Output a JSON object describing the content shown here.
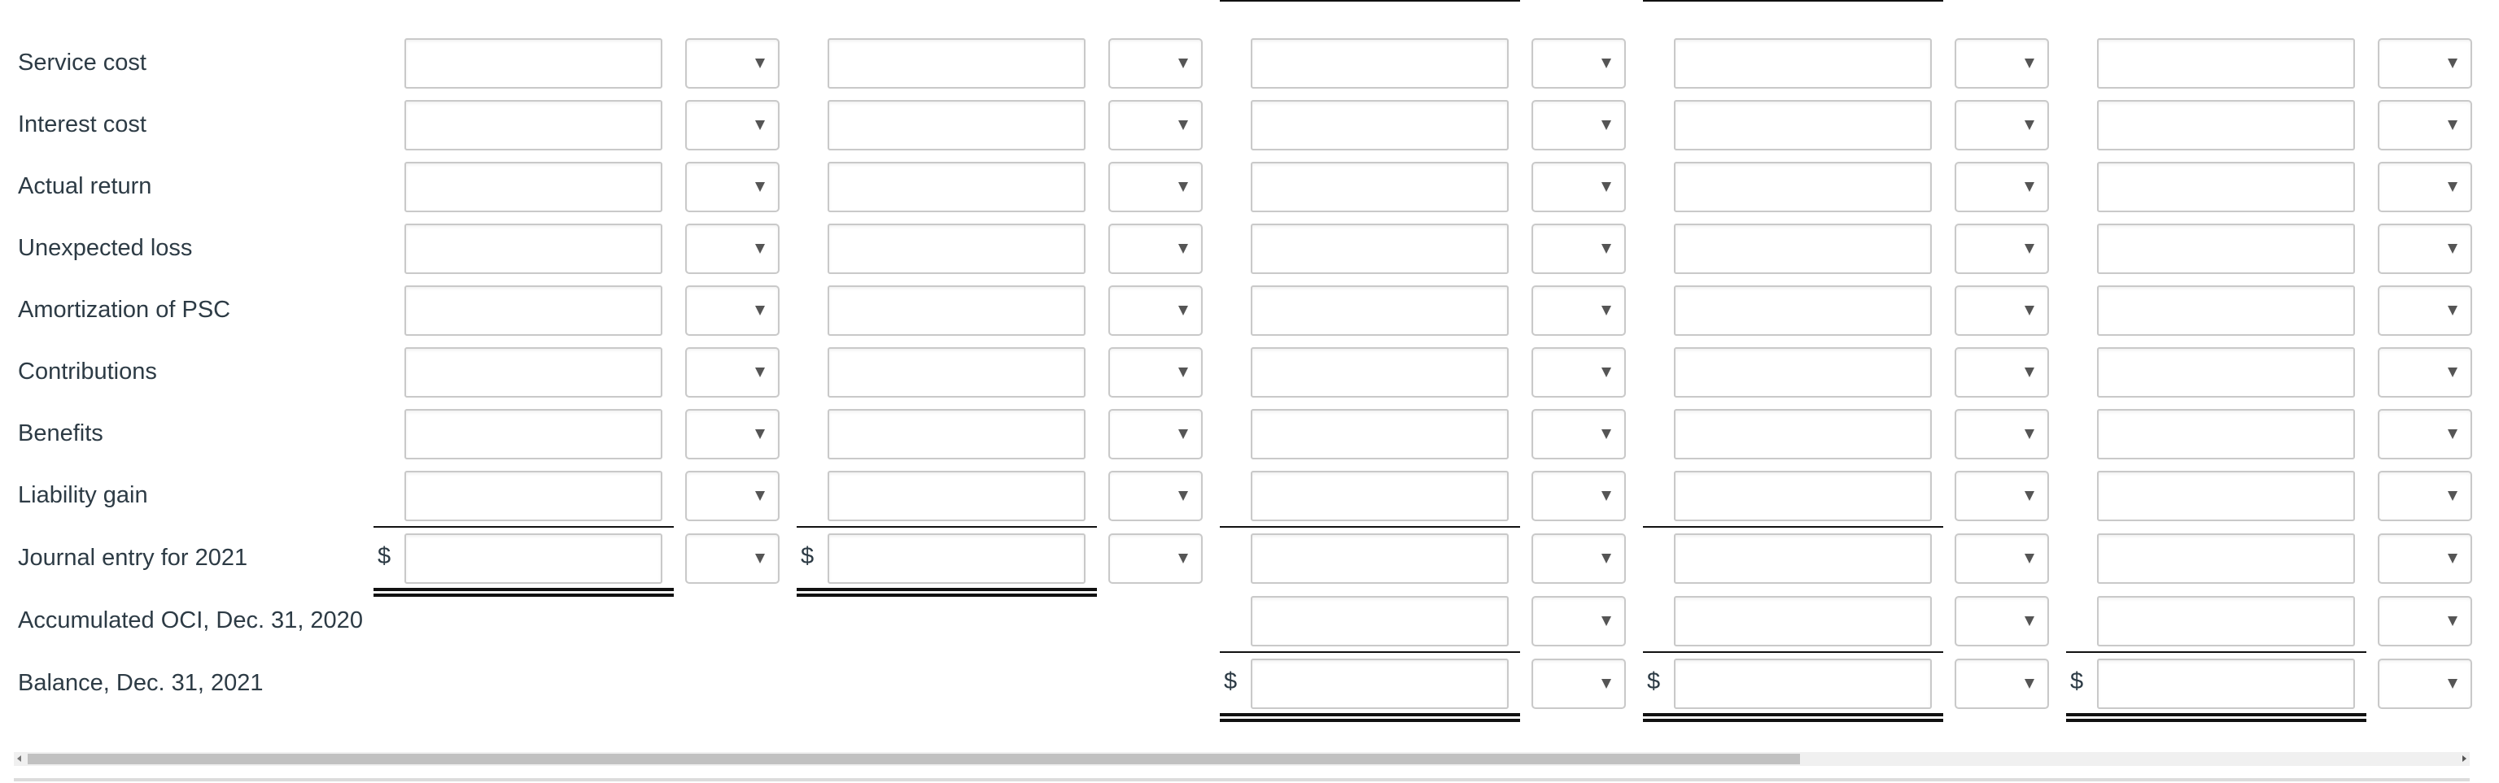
{
  "currency_symbol": "$",
  "rows": [
    {
      "label": "Service cost"
    },
    {
      "label": "Interest cost"
    },
    {
      "label": "Actual return"
    },
    {
      "label": "Unexpected loss"
    },
    {
      "label": "Amortization of PSC"
    },
    {
      "label": "Contributions"
    },
    {
      "label": "Benefits"
    },
    {
      "label": "Liability gain"
    },
    {
      "label": "Journal entry for 2021"
    },
    {
      "label": "Accumulated OCI, Dec. 31, 2020"
    },
    {
      "label": "Balance, Dec. 31, 2021"
    }
  ],
  "columns_count": 5,
  "cells": {
    "amount_value": "",
    "select_value": ""
  },
  "scrollbar": {
    "orientation": "horizontal",
    "thumb_start_fraction": 0.0,
    "thumb_visible_fraction": 0.73
  },
  "icons": {
    "select_arrow": "triangle-down-icon",
    "scroll_left": "triangle-left-icon",
    "scroll_right": "triangle-right-icon"
  }
}
